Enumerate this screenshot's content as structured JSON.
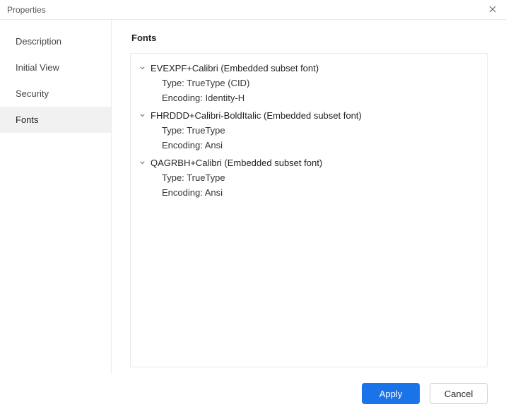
{
  "titlebar": {
    "title": "Properties"
  },
  "sidebar": {
    "items": [
      {
        "label": "Description"
      },
      {
        "label": "Initial View"
      },
      {
        "label": "Security"
      },
      {
        "label": "Fonts"
      }
    ],
    "active_index": 3
  },
  "main": {
    "heading": "Fonts",
    "fonts": [
      {
        "name": "EVEXPF+Calibri (Embedded subset font)",
        "type_label": "Type:",
        "type_value": "TrueType (CID)",
        "encoding_label": "Encoding:",
        "encoding_value": "Identity-H"
      },
      {
        "name": "FHRDDD+Calibri-BoldItalic (Embedded subset font)",
        "type_label": "Type:",
        "type_value": "TrueType",
        "encoding_label": "Encoding:",
        "encoding_value": "Ansi"
      },
      {
        "name": "QAGRBH+Calibri (Embedded subset font)",
        "type_label": "Type:",
        "type_value": "TrueType",
        "encoding_label": "Encoding:",
        "encoding_value": "Ansi"
      }
    ]
  },
  "footer": {
    "apply_label": "Apply",
    "cancel_label": "Cancel"
  }
}
